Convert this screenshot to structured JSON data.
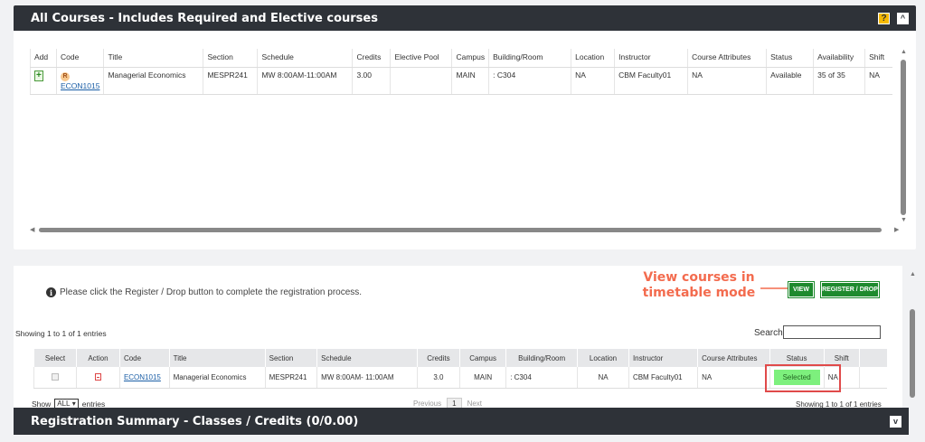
{
  "all_courses": {
    "title": "All Courses - Includes Required and Elective courses",
    "help_icon": "?",
    "collapse_icon": "^",
    "columns": [
      "Add",
      "Code",
      "Title",
      "Section",
      "Schedule",
      "Credits",
      "Elective Pool",
      "Campus",
      "Building/Room",
      "Location",
      "Instructor",
      "Course Attributes",
      "Status",
      "Availability",
      "Shift"
    ],
    "row": {
      "badge": "R",
      "code": "ECON1015",
      "title": "Managerial Economics",
      "section": "MESPR241",
      "schedule": "MW 8:00AM-11:00AM",
      "credits": "3.00",
      "elective_pool": "",
      "campus": "MAIN",
      "building_room": ": C304",
      "location": "NA",
      "instructor": "CBM Faculty01",
      "course_attributes": "NA",
      "status": "Available",
      "availability": "35 of 35",
      "shift": "NA"
    }
  },
  "registration": {
    "info": "Please click the Register / Drop button to complete the registration process.",
    "annotation_line1": "View courses in",
    "annotation_line2": "timetable mode",
    "view_button": "VIEW",
    "register_button": "REGISTER / DROP",
    "showing_top": "Showing 1 to 1 of 1 entries",
    "search_label": "Search",
    "search_value": "",
    "columns": [
      "Select",
      "Action",
      "Code",
      "Title",
      "Section",
      "Schedule",
      "Credits",
      "Campus",
      "Building/Room",
      "Location",
      "Instructor",
      "Course Attributes",
      "Status",
      "Shift"
    ],
    "row": {
      "code": "ECON1015",
      "title": "Managerial Economics",
      "section": "MESPR241",
      "schedule": "MW 8:00AM- 11:00AM",
      "credits": "3.0",
      "campus": "MAIN",
      "building_room": ": C304",
      "location": "NA",
      "instructor": "CBM Faculty01",
      "course_attributes": "NA",
      "status": "Selected",
      "shift": "NA"
    },
    "show_label": "Show",
    "show_value": "ALL",
    "entries_label": "entries",
    "previous": "Previous",
    "page": "1",
    "next": "Next",
    "showing_bottom": "Showing 1 to 1 of 1 entries"
  },
  "summary": {
    "title": "Registration Summary - Classes / Credits (0/0.00)",
    "expand_icon": "v"
  },
  "colors": {
    "header_bg": "#2e3238",
    "green_button": "#1e8a2e",
    "annotation": "#f36b4e",
    "selected": "#7df07d"
  }
}
